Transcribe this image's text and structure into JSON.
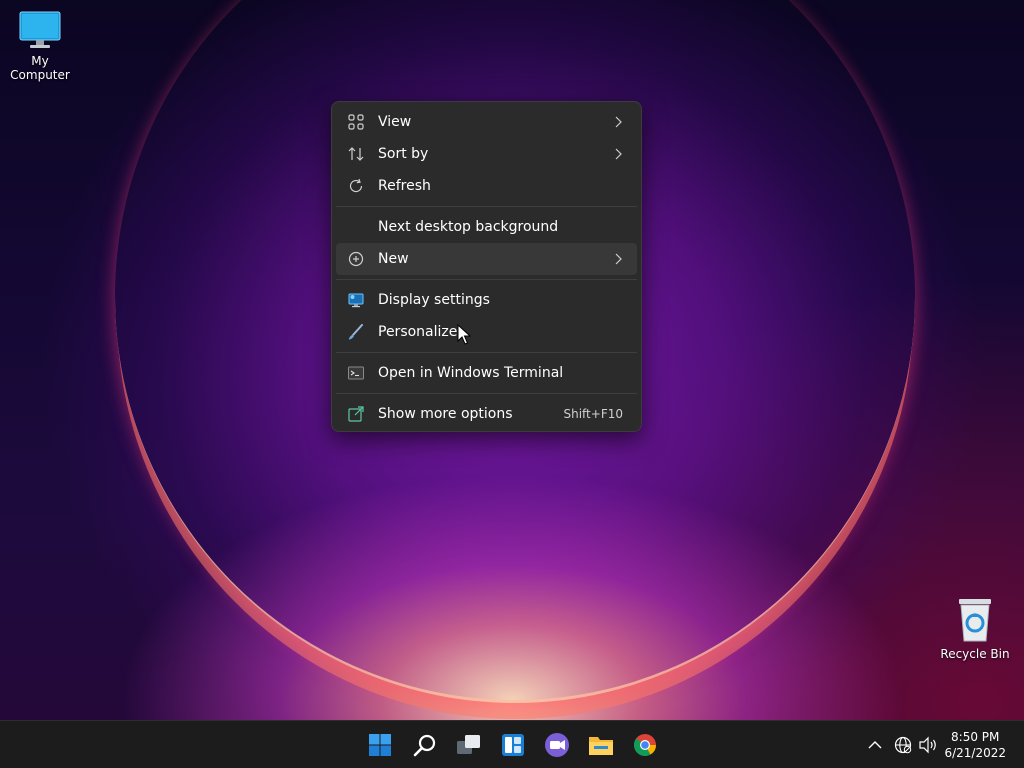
{
  "desktop": {
    "icons": [
      {
        "label": "My Computer",
        "icon": "computer-icon"
      },
      {
        "label": "Recycle Bin",
        "icon": "recycle-bin-icon"
      }
    ]
  },
  "context_menu": {
    "items": [
      {
        "label": "View",
        "icon": "grid-icon",
        "submenu": true
      },
      {
        "label": "Sort by",
        "icon": "sort-icon",
        "submenu": true
      },
      {
        "label": "Refresh",
        "icon": "refresh-icon",
        "submenu": false
      },
      {
        "label": "Next desktop background",
        "icon": "",
        "submenu": false
      },
      {
        "label": "New",
        "icon": "plus-circle-icon",
        "submenu": true,
        "highlighted": true
      },
      {
        "label": "Display settings",
        "icon": "display-icon",
        "submenu": false
      },
      {
        "label": "Personalize",
        "icon": "brush-icon",
        "submenu": false
      },
      {
        "label": "Open in Windows Terminal",
        "icon": "terminal-icon",
        "submenu": false
      },
      {
        "label": "Show more options",
        "icon": "more-options-icon",
        "shortcut": "Shift+F10"
      }
    ]
  },
  "taskbar": {
    "apps": [
      "start-icon",
      "search-icon",
      "task-view-icon",
      "widgets-icon",
      "teams-chat-icon",
      "file-explorer-icon",
      "chrome-icon"
    ],
    "tray": {
      "time": "8:50 PM",
      "date": "6/21/2022"
    }
  },
  "colors": {
    "menu_bg": "#2b2b2b",
    "menu_hover": "#383838",
    "taskbar_bg": "#1c1c1c",
    "accent": "#0078d4"
  }
}
